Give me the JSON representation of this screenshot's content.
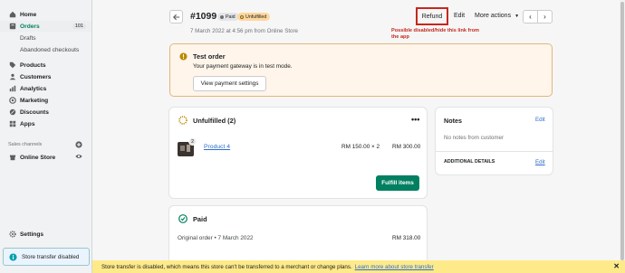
{
  "sidebar": {
    "items": [
      {
        "label": "Home",
        "icon": "home-icon"
      },
      {
        "label": "Orders",
        "icon": "orders-icon",
        "badge": "101"
      },
      {
        "label": "Drafts"
      },
      {
        "label": "Abandoned checkouts"
      },
      {
        "label": "Products",
        "icon": "tag-icon"
      },
      {
        "label": "Customers",
        "icon": "person-icon"
      },
      {
        "label": "Analytics",
        "icon": "analytics-icon"
      },
      {
        "label": "Marketing",
        "icon": "marketing-icon"
      },
      {
        "label": "Discounts",
        "icon": "discount-icon"
      },
      {
        "label": "Apps",
        "icon": "apps-icon"
      }
    ],
    "sales_channels_label": "Sales channels",
    "online_store": "Online Store",
    "settings": "Settings",
    "store_transfer": "Store transfer disabled"
  },
  "header": {
    "order_number": "#1099",
    "paid_pill": "Paid",
    "unfulfilled_pill": "Unfulfilled",
    "subtitle": "7 March 2022 at 4:56 pm from Online Store",
    "refund": "Refund",
    "edit": "Edit",
    "more_actions": "More actions",
    "annotation": "Possible disabled/hide this link from the app"
  },
  "banner": {
    "title": "Test order",
    "text": "Your payment gateway is in test mode.",
    "button": "View payment settings"
  },
  "unfulfilled": {
    "title": "Unfulfilled (2)",
    "product_name": "Product 4",
    "quantity_badge": "2",
    "price": "RM 150.00 × 2",
    "total": "RM 300.00",
    "fulfill_button": "Fulfill items"
  },
  "paid": {
    "title": "Paid",
    "line": "Original order • 7 March 2022",
    "amount": "RM 318.00"
  },
  "notes": {
    "title": "Notes",
    "edit": "Edit",
    "empty": "No notes from customer",
    "additional_details": "ADDITIONAL DETAILS",
    "additional_edit": "Edit"
  },
  "bottom_bar": {
    "text": "Store transfer is disabled, which means this store can't be transferred to a merchant or change plans.",
    "link": "Learn more about store transfer"
  },
  "colors": {
    "accent_green": "#008060",
    "warning_border": "#e1b878",
    "annotation_red": "#c5281c",
    "link_blue": "#2c6ecb"
  }
}
